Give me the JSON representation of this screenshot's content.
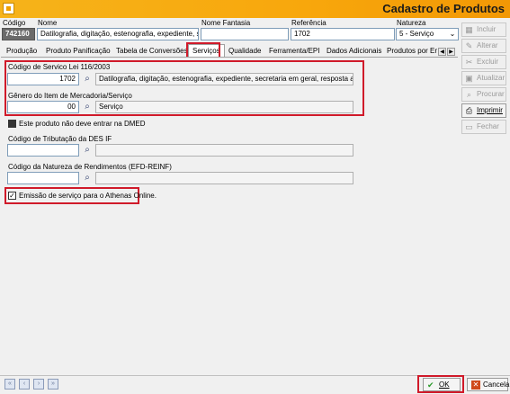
{
  "window": {
    "title": "Cadastro de Produtos"
  },
  "header": {
    "labels": {
      "codigo": "Código",
      "nome": "Nome",
      "nome_fantasia": "Nome Fantasia",
      "referencia": "Referência",
      "natureza": "Natureza"
    },
    "codigo": "742160",
    "nome": "Datilografia, digitação, estenografia, expediente, secreta",
    "nome_fantasia": "",
    "referencia": "1702",
    "natureza": "5 - Serviço"
  },
  "tabs": [
    {
      "label": "Produção"
    },
    {
      "label": "Produto Panificação"
    },
    {
      "label": "Tabela de Conversões"
    },
    {
      "label": "Serviços"
    },
    {
      "label": "Qualidade"
    },
    {
      "label": "Ferramenta/EPI"
    },
    {
      "label": "Dados Adicionais"
    },
    {
      "label": "Produtos por Empr"
    }
  ],
  "servicos": {
    "codigo_servico_label": "Código de Servico Lei 116/2003",
    "codigo_servico_value": "1702",
    "codigo_servico_desc": "Datilografia, digitação, estenografia, expediente, secretaria em geral, resposta audível, redaç",
    "genero_label": "Gênero do Item de Mercadoria/Serviço",
    "genero_value": "00",
    "genero_desc": "Serviço",
    "dmed_label": "Este produto não deve entrar na DMED",
    "tributacao_label": "Código de Tributação da DES IF",
    "tributacao_value": "",
    "tributacao_desc": "",
    "reinf_label": "Código da Natureza de Rendimentos (EFD-REINF)",
    "reinf_value": "",
    "reinf_desc": "",
    "athenas_label": "Emissão de serviço para o Athenas Online."
  },
  "side_buttons": [
    {
      "label": "Incluir",
      "enabled": false
    },
    {
      "label": "Alterar",
      "enabled": false
    },
    {
      "label": "Excluir",
      "enabled": false
    },
    {
      "label": "Atualizar",
      "enabled": false
    },
    {
      "label": "Procurar",
      "enabled": false
    },
    {
      "label": "Imprimir",
      "enabled": true
    },
    {
      "label": "Fechar",
      "enabled": false
    }
  ],
  "bottom": {
    "ok_label": "OK",
    "cancel_label": "Cancela"
  },
  "colors": {
    "title_bar": "#f8a70c",
    "highlight": "#d01a2a"
  }
}
